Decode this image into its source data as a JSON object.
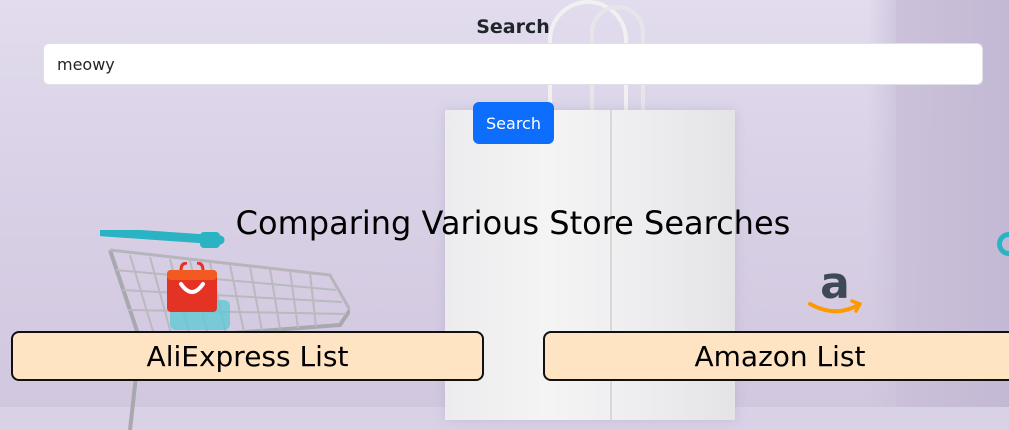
{
  "search": {
    "label": "Search",
    "value": "meowy",
    "button_label": "Search"
  },
  "main": {
    "title": "Comparing Various Store Searches"
  },
  "stores": [
    {
      "label": "AliExpress List",
      "icon": "aliexpress-logo-icon",
      "color": "#e43225"
    },
    {
      "label": "Amazon List",
      "icon": "amazon-logo-icon",
      "color": "#232f3e",
      "accent": "#ff9900"
    }
  ],
  "colors": {
    "primary_button": "#0d6efd",
    "list_button_bg": "#ffe4c4"
  }
}
